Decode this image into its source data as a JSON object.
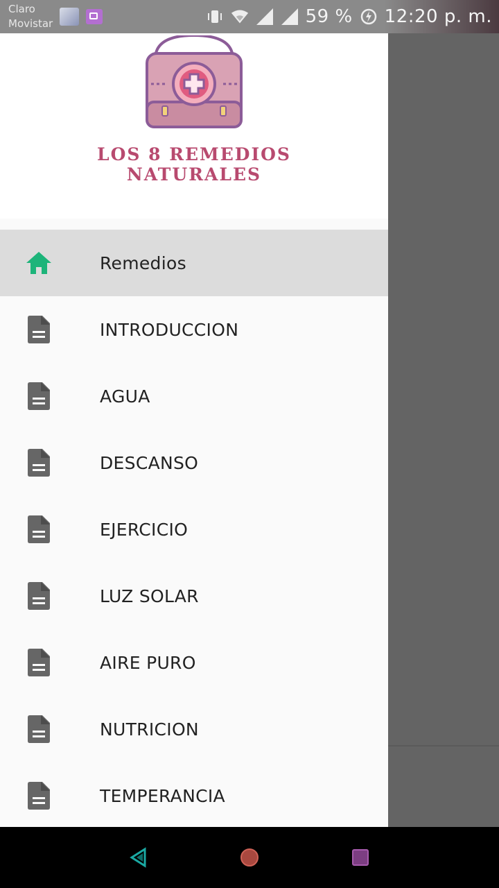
{
  "statusbar": {
    "carrier_line1": "Claro",
    "carrier_line2": "Movistar",
    "battery": "59 %",
    "time": "12:20 p. m.",
    "icons": [
      "avatar-notification-icon",
      "gallery-notification-icon",
      "vibrate-icon",
      "wifi-icon",
      "signal-icon",
      "signal-icon",
      "battery-charging-icon"
    ]
  },
  "drawer": {
    "brand_line1": "LOS 8 REMEDIOS",
    "brand_line2": "NATURALES",
    "logo_icon": "first-aid-kit-icon",
    "accent_color": "#b84a6f",
    "active_icon_color": "#1db47a",
    "items": [
      {
        "label": "Remedios",
        "icon": "home-icon",
        "active": true
      },
      {
        "label": "INTRODUCCION",
        "icon": "document-icon"
      },
      {
        "label": "AGUA",
        "icon": "document-icon"
      },
      {
        "label": "DESCANSO",
        "icon": "document-icon"
      },
      {
        "label": "EJERCICIO",
        "icon": "document-icon"
      },
      {
        "label": "LUZ SOLAR",
        "icon": "document-icon"
      },
      {
        "label": "AIRE PURO",
        "icon": "document-icon"
      },
      {
        "label": "NUTRICION",
        "icon": "document-icon"
      },
      {
        "label": "TEMPERANCIA",
        "icon": "document-icon"
      }
    ]
  },
  "navbar": {
    "buttons": [
      "back-icon",
      "home-circle-icon",
      "recents-square-icon"
    ]
  }
}
